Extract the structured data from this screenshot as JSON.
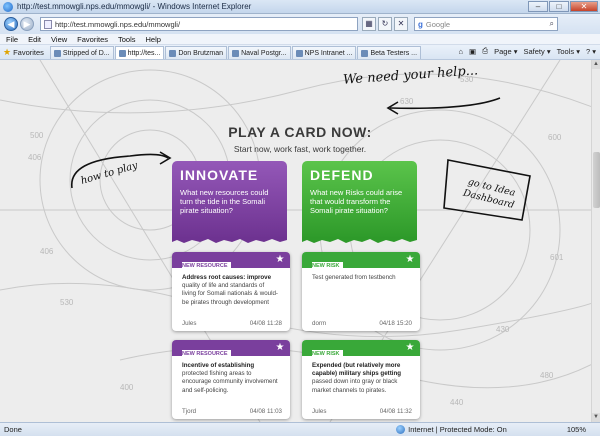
{
  "window": {
    "title": "http://test.mmowgli.nps.edu/mmowgli/ - Windows Internet Explorer",
    "minimize": "–",
    "maximize": "□",
    "close": "✕"
  },
  "address": {
    "url": "http://test.mmowgli.nps.edu/mmowgli/",
    "search_placeholder": "Google"
  },
  "menu": [
    "File",
    "Edit",
    "View",
    "Favorites",
    "Tools",
    "Help"
  ],
  "tabs": {
    "favorites_label": "Favorites",
    "items": [
      {
        "label": "Stripped of D...",
        "active": false
      },
      {
        "label": "http://tes...",
        "active": true
      },
      {
        "label": "Don Brutzman",
        "active": false
      },
      {
        "label": "Naval Postgr...",
        "active": false
      },
      {
        "label": "NPS Intranet ...",
        "active": false
      },
      {
        "label": "Beta Testers ...",
        "active": false
      }
    ],
    "tools": [
      "Page ▾",
      "Safety ▾",
      "Tools ▾",
      "? ▾"
    ]
  },
  "page": {
    "heading": "PLAY A CARD NOW:",
    "subheading": "Start now, work fast, work together.",
    "handwritten": {
      "need_help": "We need your help...",
      "how_to_play": "how to play",
      "dashboard": "go to Idea Dashboard"
    },
    "big_cards": {
      "innovate": {
        "name": "INNOVATE",
        "question": "What new resources could turn the tide in the Somali pirate situation?"
      },
      "defend": {
        "name": "DEFEND",
        "question": "What new Risks could arise that would transform the Somali pirate situation?"
      }
    },
    "cards": [
      {
        "type": "NEW RESOURCE",
        "title": "Address root causes: improve",
        "text": " quality of life and standards of living for Somali nationals & would-be pirates through development",
        "author": "Jules",
        "date": "04/08 11:28"
      },
      {
        "type": "NEW RISK",
        "title": "",
        "text": "Test generated from testbench",
        "author": "dorm",
        "date": "04/18 15:20"
      },
      {
        "type": "NEW RESOURCE",
        "title": "Incentive of establishing",
        "text": " protected fishing areas to encourage community involvement and self-policing.",
        "author": "Tjord",
        "date": "04/08 11:03"
      },
      {
        "type": "NEW RISK",
        "title": "Expended (but relatively more capable) military ships getting",
        "text": " passed down into gray or black market channels to pirates.",
        "author": "Jules",
        "date": "04/08 11:32"
      }
    ],
    "map_numbers": [
      "530",
      "630",
      "600",
      "500",
      "406",
      "406",
      "601",
      "530",
      "430",
      "400",
      "480",
      "440"
    ]
  },
  "status": {
    "left": "Done",
    "zone": "Internet | Protected Mode: On",
    "zoom": "105%"
  },
  "colors": {
    "innovate": "#7a3f9d",
    "defend": "#39a839"
  }
}
